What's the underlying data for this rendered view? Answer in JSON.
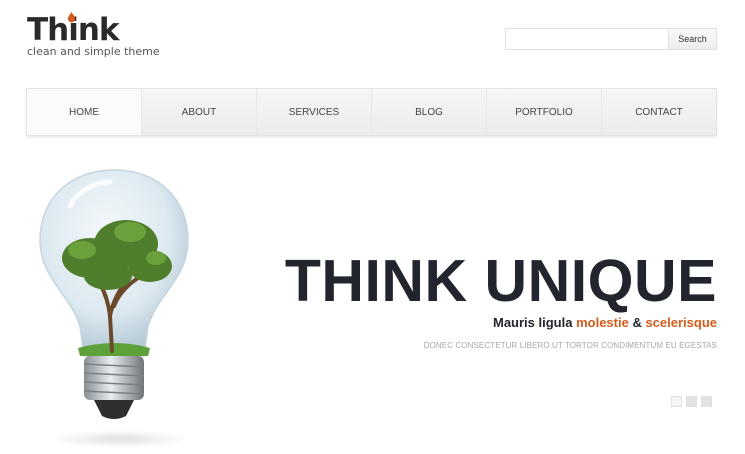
{
  "brand": {
    "name": "Think",
    "tagline": "clean and simple theme",
    "accent_color": "#d35b1c",
    "icon": "flame-drop-icon"
  },
  "search": {
    "placeholder": "",
    "button_label": "Search"
  },
  "nav": {
    "items": [
      {
        "label": "HOME"
      },
      {
        "label": "ABOUT"
      },
      {
        "label": "SERVICES"
      },
      {
        "label": "BLOG"
      },
      {
        "label": "PORTFOLIO"
      },
      {
        "label": "CONTACT"
      }
    ]
  },
  "hero": {
    "image": "lightbulb-tree-icon",
    "headline": "THINK UNIQUE",
    "subline": {
      "part1": "Mauris ligula ",
      "accent1": "molestie",
      "part2": " & ",
      "accent2": "scelerisque"
    },
    "caption": "DONEC CONSECTETUR LIBERO UT TORTOR CONDIMENTUM EU EGESTAS",
    "slide_count": 3,
    "active_slide": 1
  }
}
